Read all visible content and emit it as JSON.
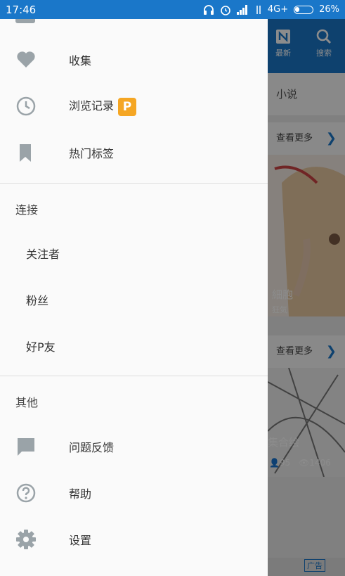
{
  "status_bar": {
    "time": "17:46",
    "network": "4G+",
    "battery": "26%"
  },
  "drawer": {
    "items": [
      {
        "label": "收集",
        "icon": "heart-icon"
      },
      {
        "label": "浏览记录",
        "icon": "clock-icon",
        "badge": "P"
      },
      {
        "label": "热门标签",
        "icon": "bookmark-icon"
      }
    ],
    "connect_section": {
      "title": "连接",
      "items": [
        {
          "label": "关注者"
        },
        {
          "label": "粉丝"
        },
        {
          "label": "好P友"
        }
      ]
    },
    "other_section": {
      "title": "其他",
      "items": [
        {
          "label": "问题反馈",
          "icon": "chat-bubble-icon"
        },
        {
          "label": "帮助",
          "icon": "help-circle-icon"
        },
        {
          "label": "设置",
          "icon": "gear-icon"
        }
      ]
    }
  },
  "background_app": {
    "tabs": [
      {
        "label": "最新",
        "icon": "n-icon"
      },
      {
        "label": "搜索",
        "icon": "search-icon"
      }
    ],
    "subtab": "小说",
    "see_more_1": "查看更多",
    "card1_title": "細胞",
    "card1_author": "狂気",
    "see_more_2": "查看更多",
    "card2_title": "集合绘",
    "card2_likes": "95",
    "card2_views": "1406",
    "ad_label": "广告"
  },
  "colors": {
    "primary": "#1a77c9",
    "badge": "#f5a623",
    "icon_gray": "#9aa3a8"
  }
}
